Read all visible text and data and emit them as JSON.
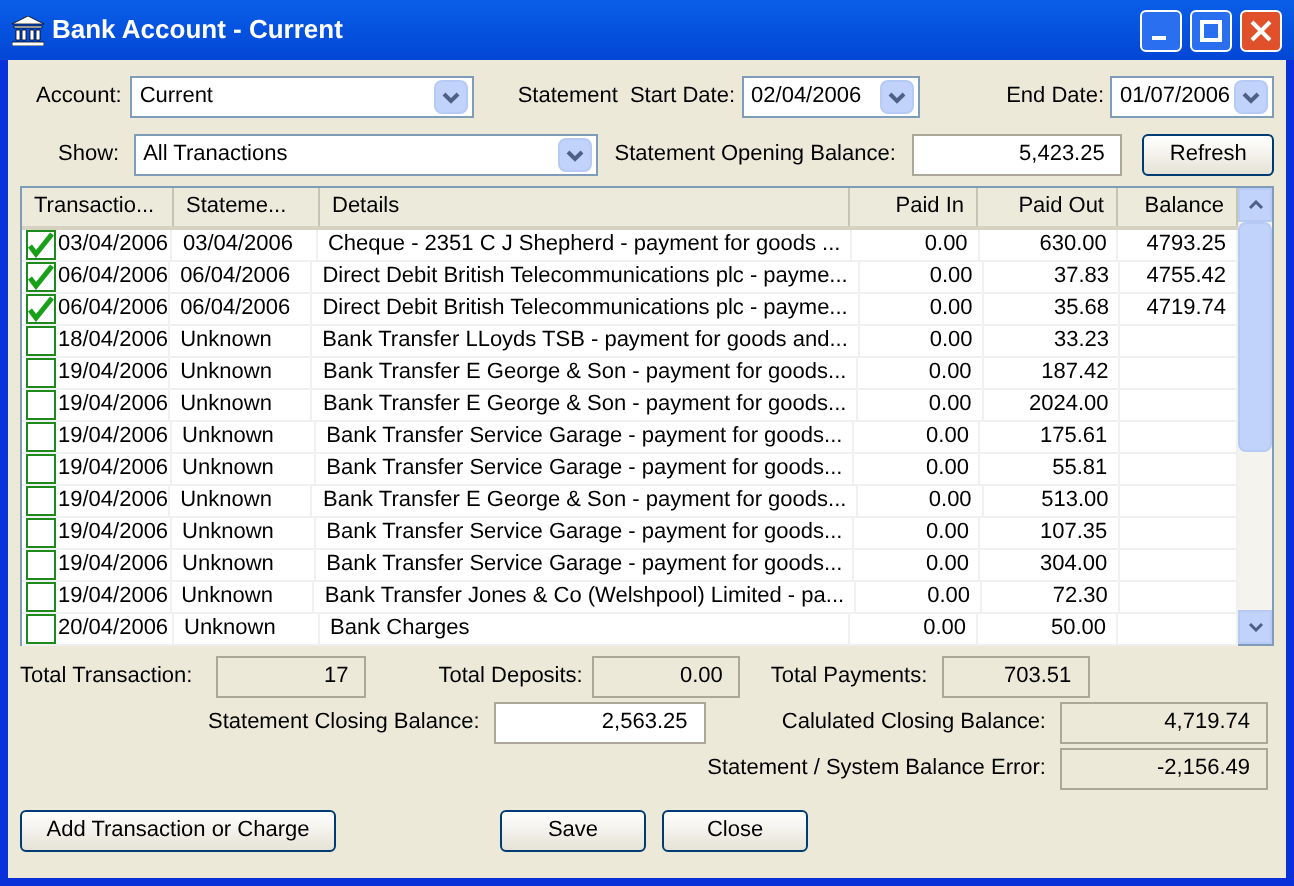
{
  "window": {
    "title": "Bank Account - Current"
  },
  "account": {
    "label": "Account:",
    "value": "Current"
  },
  "statement_label": "Statement",
  "start_date": {
    "label": "Start Date:",
    "value": "02/04/2006"
  },
  "end_date": {
    "label": "End Date:",
    "value": "01/07/2006"
  },
  "show": {
    "label": "Show:",
    "value": "All Tranactions"
  },
  "opening_balance": {
    "label": "Statement Opening Balance:",
    "value": "5,423.25"
  },
  "refresh_button": "Refresh",
  "table": {
    "columns": [
      "Transactio...",
      "Stateme...",
      "Details",
      "Paid In",
      "Paid Out",
      "Balance"
    ],
    "rows": [
      {
        "checked": true,
        "cells": [
          "03/04/2006",
          "03/04/2006",
          "Cheque - 2351 C J Shepherd - payment for goods ...",
          "0.00",
          "630.00",
          "4793.25"
        ]
      },
      {
        "checked": true,
        "cells": [
          "06/04/2006",
          "06/04/2006",
          "Direct Debit British Telecommunications plc - payme...",
          "0.00",
          "37.83",
          "4755.42"
        ]
      },
      {
        "checked": true,
        "cells": [
          "06/04/2006",
          "06/04/2006",
          "Direct Debit British Telecommunications plc - payme...",
          "0.00",
          "35.68",
          "4719.74"
        ]
      },
      {
        "checked": false,
        "cells": [
          "18/04/2006",
          "Unknown",
          "Bank Transfer LLoyds TSB - payment for goods and...",
          "0.00",
          "33.23",
          ""
        ]
      },
      {
        "checked": false,
        "cells": [
          "19/04/2006",
          "Unknown",
          "Bank Transfer E George & Son - payment for goods...",
          "0.00",
          "187.42",
          ""
        ]
      },
      {
        "checked": false,
        "cells": [
          "19/04/2006",
          "Unknown",
          "Bank Transfer E George & Son - payment for goods...",
          "0.00",
          "2024.00",
          ""
        ]
      },
      {
        "checked": false,
        "cells": [
          "19/04/2006",
          "Unknown",
          "Bank Transfer Service Garage - payment for goods...",
          "0.00",
          "175.61",
          ""
        ]
      },
      {
        "checked": false,
        "cells": [
          "19/04/2006",
          "Unknown",
          "Bank Transfer Service Garage - payment for goods...",
          "0.00",
          "55.81",
          ""
        ]
      },
      {
        "checked": false,
        "cells": [
          "19/04/2006",
          "Unknown",
          "Bank Transfer E George & Son - payment for goods...",
          "0.00",
          "513.00",
          ""
        ]
      },
      {
        "checked": false,
        "cells": [
          "19/04/2006",
          "Unknown",
          "Bank Transfer Service Garage - payment for goods...",
          "0.00",
          "107.35",
          ""
        ]
      },
      {
        "checked": false,
        "cells": [
          "19/04/2006",
          "Unknown",
          "Bank Transfer Service Garage - payment for goods...",
          "0.00",
          "304.00",
          ""
        ]
      },
      {
        "checked": false,
        "cells": [
          "19/04/2006",
          "Unknown",
          "Bank Transfer Jones & Co (Welshpool) Limited - pa...",
          "0.00",
          "72.30",
          ""
        ]
      },
      {
        "checked": false,
        "cells": [
          "20/04/2006",
          "Unknown",
          "Bank Charges",
          "0.00",
          "50.00",
          ""
        ]
      }
    ]
  },
  "totals": {
    "transactions": {
      "label": "Total Transaction:",
      "value": "17"
    },
    "deposits": {
      "label": "Total Deposits:",
      "value": "0.00"
    },
    "payments": {
      "label": "Total Payments:",
      "value": "703.51"
    }
  },
  "closing_balance": {
    "label": "Statement Closing Balance:",
    "value": "2,563.25"
  },
  "calculated_closing": {
    "label": "Calulated Closing Balance:",
    "value": "4,719.74"
  },
  "balance_error": {
    "label": "Statement / System Balance Error:",
    "value": "-2,156.49"
  },
  "buttons": [
    "Add Transaction or Charge",
    "Save",
    "Close"
  ]
}
